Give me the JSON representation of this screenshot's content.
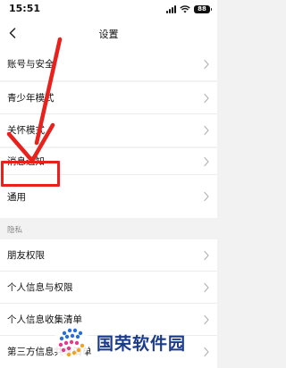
{
  "status_bar": {
    "time": "15:51",
    "battery": "88"
  },
  "nav": {
    "title": "设置"
  },
  "sections": {
    "account": {
      "label": "账号与安全"
    },
    "youth": {
      "label": "青少年模式"
    },
    "care": {
      "label": "关怀模式"
    },
    "message": {
      "label": "消息通知"
    },
    "general": {
      "label": "通用"
    }
  },
  "privacy": {
    "header": "隐私",
    "items": [
      {
        "label": "朋友权限"
      },
      {
        "label": "个人信息与权限"
      },
      {
        "label": "个人信息收集清单"
      },
      {
        "label": "第三方信息共享清单"
      }
    ]
  },
  "watermark": {
    "text": "国荣软件园"
  },
  "colors": {
    "highlight": "#e8211c",
    "background": "#f2f2f2",
    "watermark": "#1a3a8a"
  }
}
